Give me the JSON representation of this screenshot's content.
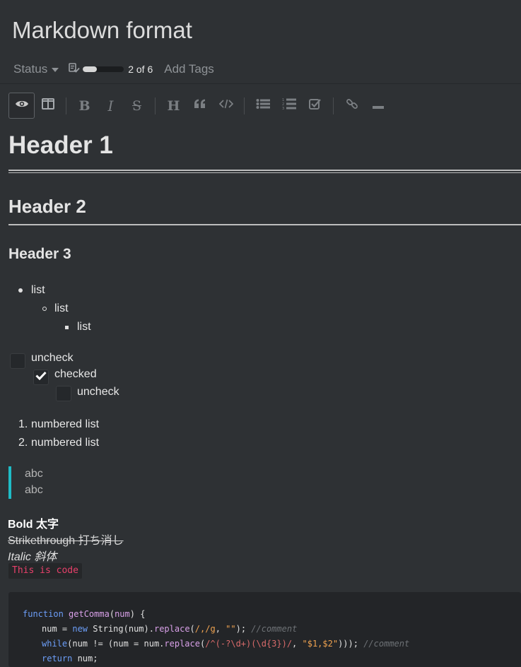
{
  "note": {
    "title": "Markdown format",
    "status_label": "Status",
    "progress": {
      "done": 2,
      "total": 6,
      "text": "2 of 6",
      "fraction": 0.333
    },
    "add_tags_label": "Add Tags"
  },
  "toolbar": {
    "buttons": [
      {
        "name": "preview",
        "icon": "eye-icon",
        "active": true
      },
      {
        "name": "split-view",
        "icon": "columns-icon"
      },
      {
        "name": "bold",
        "icon": "bold-icon",
        "glyph": "B"
      },
      {
        "name": "italic",
        "icon": "italic-icon",
        "glyph": "I"
      },
      {
        "name": "strikethrough",
        "icon": "strikethrough-icon",
        "glyph": "S"
      },
      {
        "name": "heading",
        "icon": "heading-icon",
        "glyph": "H"
      },
      {
        "name": "quote",
        "icon": "quote-icon",
        "glyph": "❝"
      },
      {
        "name": "code",
        "icon": "code-icon",
        "glyph": "</>"
      },
      {
        "name": "bulleted-list",
        "icon": "list-ul-icon"
      },
      {
        "name": "numbered-list",
        "icon": "list-ol-icon"
      },
      {
        "name": "checklist",
        "icon": "check-square-icon"
      },
      {
        "name": "link",
        "icon": "link-icon"
      },
      {
        "name": "horizontal-rule",
        "icon": "minus-icon"
      }
    ]
  },
  "content": {
    "h1": "Header 1",
    "h2": "Header 2",
    "h3": "Header 3",
    "bullets": [
      "list",
      "list",
      "list"
    ],
    "tasks": [
      {
        "label": "uncheck",
        "checked": false
      },
      {
        "label": "checked",
        "checked": true
      },
      {
        "label": "uncheck",
        "checked": false
      }
    ],
    "numbered": [
      {
        "marker": "1.",
        "label": "numbered list"
      },
      {
        "marker": "2.",
        "label": "numbered list"
      }
    ],
    "blockquote": [
      "abc",
      "abc"
    ],
    "bold_text": "Bold 太字",
    "strike_text": "Strikethrough 打ち消し",
    "italic_text": "Italic 斜体",
    "inline_code": "This is code",
    "code_block": {
      "line1": {
        "kw": "function",
        "fn": "getComma",
        "param": "num",
        "rest": ") {"
      },
      "line2": {
        "a": "num = ",
        "kw": "new",
        "b": " String(num).",
        "fn": "replace",
        "c": "(",
        "re": "/,/g",
        "d": ", ",
        "s": "\"\"",
        "e": "); ",
        "comment": "//comment"
      },
      "line3": {
        "kw": "while",
        "a": "(num != (num = num.",
        "fn": "replace",
        "b": "(",
        "re": "/^(-?\\d+)(\\d{3})/",
        "c": ", ",
        "s": "\"$1,$2\"",
        "d": "))); ",
        "comment": "//comment"
      },
      "line4": {
        "kw": "return",
        "rest": " num;"
      }
    }
  }
}
